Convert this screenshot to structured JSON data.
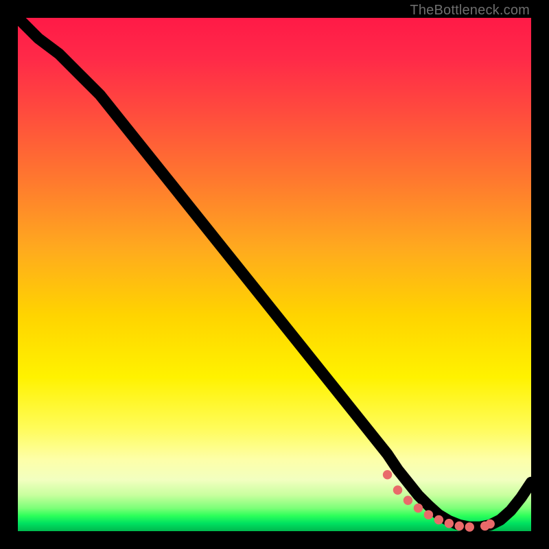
{
  "attribution": "TheBottleneck.com",
  "chart_data": {
    "type": "line",
    "title": "",
    "xlabel": "",
    "ylabel": "",
    "xlim": [
      0,
      100
    ],
    "ylim": [
      0,
      100
    ],
    "x": [
      0,
      4,
      8,
      12,
      16,
      20,
      24,
      28,
      32,
      36,
      40,
      44,
      48,
      52,
      56,
      60,
      64,
      68,
      72,
      74,
      76,
      78,
      80,
      82,
      84,
      86,
      88,
      90,
      92,
      94,
      96,
      98,
      100
    ],
    "values": [
      100,
      96,
      93,
      89,
      85,
      80,
      75,
      70,
      65,
      60,
      55,
      50,
      45,
      40,
      35,
      30,
      25,
      20,
      15,
      12,
      9.5,
      7.0,
      5.0,
      3.2,
      2.0,
      1.2,
      0.8,
      0.8,
      1.2,
      2.2,
      4.0,
      6.5,
      9.5
    ],
    "optimum_band": {
      "x": [
        72,
        74,
        76,
        78,
        80,
        82,
        84,
        86,
        88,
        91,
        92
      ],
      "y": [
        11,
        8,
        6,
        4.5,
        3.2,
        2.2,
        1.5,
        1.0,
        0.8,
        1.0,
        1.4
      ]
    },
    "colors": {
      "curve": "#000000",
      "dots": "#e96a6a"
    }
  }
}
